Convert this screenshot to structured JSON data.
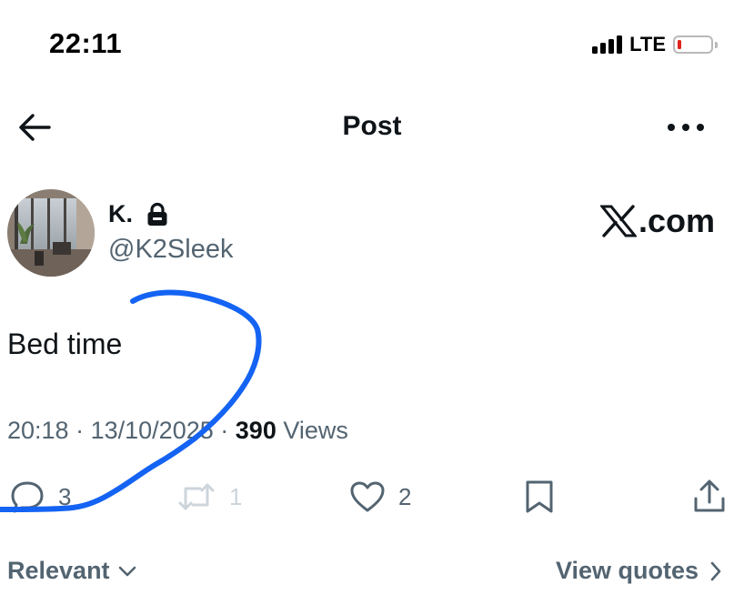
{
  "status_bar": {
    "time": "22:11",
    "network": "LTE",
    "signal_bars": 4,
    "battery_level": 0.08,
    "battery_color": "#e0241c"
  },
  "header": {
    "title": "Post",
    "back_icon": "arrow-left-icon",
    "more_icon": "more-horizontal-icon"
  },
  "author": {
    "name": "K.",
    "handle": "@K2Sleek",
    "protected_icon": "lock-icon"
  },
  "watermark": {
    "logo_letter": "X",
    "suffix": ".com"
  },
  "post": {
    "text": "Bed time",
    "time": "20:18",
    "separator": "·",
    "date": "13/10/2025",
    "views_count": "390",
    "views_label": "Views"
  },
  "actions": {
    "replies": "3",
    "reposts": "1",
    "likes": "2",
    "reply_icon": "reply-bubble-icon",
    "repost_icon": "repost-icon",
    "like_icon": "heart-icon",
    "bookmark_icon": "bookmark-icon",
    "share_icon": "share-icon"
  },
  "footer": {
    "sort_label": "Relevant",
    "quotes_label": "View quotes"
  },
  "colors": {
    "text_primary": "#0f1419",
    "text_secondary": "#536471",
    "disabled": "#cdd5db",
    "scribble": "#1463f3"
  }
}
